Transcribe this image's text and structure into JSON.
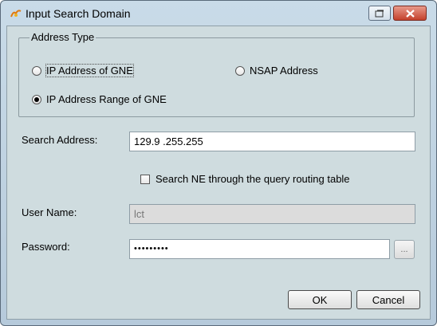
{
  "window": {
    "title": "Input Search Domain",
    "icons": {
      "app": "app-logo-icon",
      "restore": "restore-icon",
      "close": "close-icon"
    }
  },
  "address_type": {
    "legend": "Address Type",
    "options": [
      {
        "label": "IP Address of GNE",
        "checked": false
      },
      {
        "label": "NSAP Address",
        "checked": false
      },
      {
        "label": "IP Address Range of GNE",
        "checked": true
      }
    ]
  },
  "search_address": {
    "label": "Search Address:",
    "value": "129.9  .255.255"
  },
  "routing_checkbox": {
    "label": "Search NE through the query routing table",
    "checked": false
  },
  "user_name": {
    "label": "User Name:",
    "value": "lct"
  },
  "password": {
    "label": "Password:",
    "value": "•••••••••",
    "browse_label": "..."
  },
  "buttons": {
    "ok": "OK",
    "cancel": "Cancel"
  },
  "colors": {
    "panel": "#cfdcdf",
    "titlebar": "#c9dbe8",
    "close": "#c4412c"
  }
}
